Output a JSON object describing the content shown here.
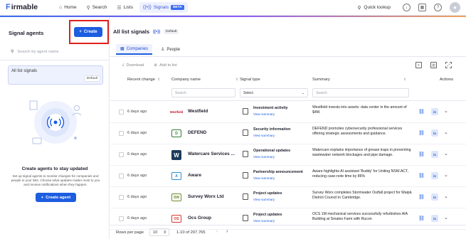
{
  "app": {
    "logo": "Firmable",
    "logo_mark": "F",
    "logo_rest": "irmable"
  },
  "nav": {
    "items": [
      {
        "label": "Home",
        "icon": "home-icon"
      },
      {
        "label": "Search",
        "icon": "search-icon"
      },
      {
        "label": "Lists",
        "icon": "list-icon"
      },
      {
        "label": "Signals",
        "icon": "signal-icon",
        "badge": "BETA",
        "active": true
      }
    ],
    "quick_lookup": "Quick lookup"
  },
  "left": {
    "title": "Signal agents",
    "create_label": "Create",
    "search_placeholder": "Search by agent name",
    "list_item": {
      "name": "All list signals",
      "tag": "Default"
    },
    "empty_title": "Create agents to stay updated",
    "empty_desc": "Set up signal agents to monitor changes for companies and people in your lists. Choose what updates matter most to you and receive notifications when they happen.",
    "create_agent_label": "Create agent"
  },
  "main": {
    "title": "All list signals",
    "default_badge": "Default",
    "tabs": [
      {
        "label": "Companies",
        "active": true
      },
      {
        "label": "People",
        "active": false
      }
    ],
    "actions": {
      "download": "Download",
      "add_to_list": "Add to list"
    },
    "columns": {
      "recent_change": "Recent change",
      "company_name": "Company name",
      "signal_type": "Signal type",
      "summary": "Summary",
      "actions": "Actions"
    },
    "filters": {
      "company_placeholder": "Search",
      "signal_select": "Select",
      "summary_placeholder": "Search"
    },
    "rows": [
      {
        "ago": "6 days ago",
        "logo": "Westfield",
        "logo_color": "#c8102e",
        "company": "Westfield",
        "signal": "Investment activity",
        "view": "View summary",
        "summary": "Westfield invests into assets: data center in the amount of $4M."
      },
      {
        "ago": "6 days ago",
        "logo": "D",
        "logo_color": "#2f7d32",
        "company": "DEFEND",
        "signal": "Security information",
        "view": "View summary",
        "summary": "DEFEND promotes cybersecurity professional services offering strategic assessments and guidance."
      },
      {
        "ago": "6 days ago",
        "logo": "W",
        "logo_color": "#1b3a5a",
        "company": "Watercare Services ...",
        "signal": "Operational updates",
        "view": "View summary",
        "summary": "Watercare explains importance of grease traps in preventing wastewater network blockages and pipe damage."
      },
      {
        "ago": "6 days ago",
        "logo": "A",
        "logo_color": "#2b8fd6",
        "company": "Aware",
        "signal": "Partnership announcement",
        "view": "View summary",
        "summary": "Aware highlights AI assistant 'Buddy' for Uniting NSW.ACT, reducing case-note time by 86%"
      },
      {
        "ago": "6 days ago",
        "logo": "SW",
        "logo_color": "#6b8a2e",
        "company": "Survey Worx Ltd",
        "signal": "Project updates",
        "view": "View summary",
        "summary": "Survey Worx completes Stormwater Outfall project for Waipā District Council in Cambridge."
      },
      {
        "ago": "6 days ago",
        "logo": "OS",
        "logo_color": "#d43a2f",
        "company": "Ocs Group",
        "signal": "Project updates",
        "view": "View summary",
        "summary": "OCS 1M mechanical services successfully refurbishes AIA Building at Smales Farm with Rucon"
      }
    ],
    "pager": {
      "label": "Rows per page",
      "per_page": "10",
      "range": "1-10 of 207,765"
    }
  },
  "colors": {
    "accent": "#1d5de0",
    "highlight": "#e0201b",
    "active_bg": "#eef1ff"
  }
}
